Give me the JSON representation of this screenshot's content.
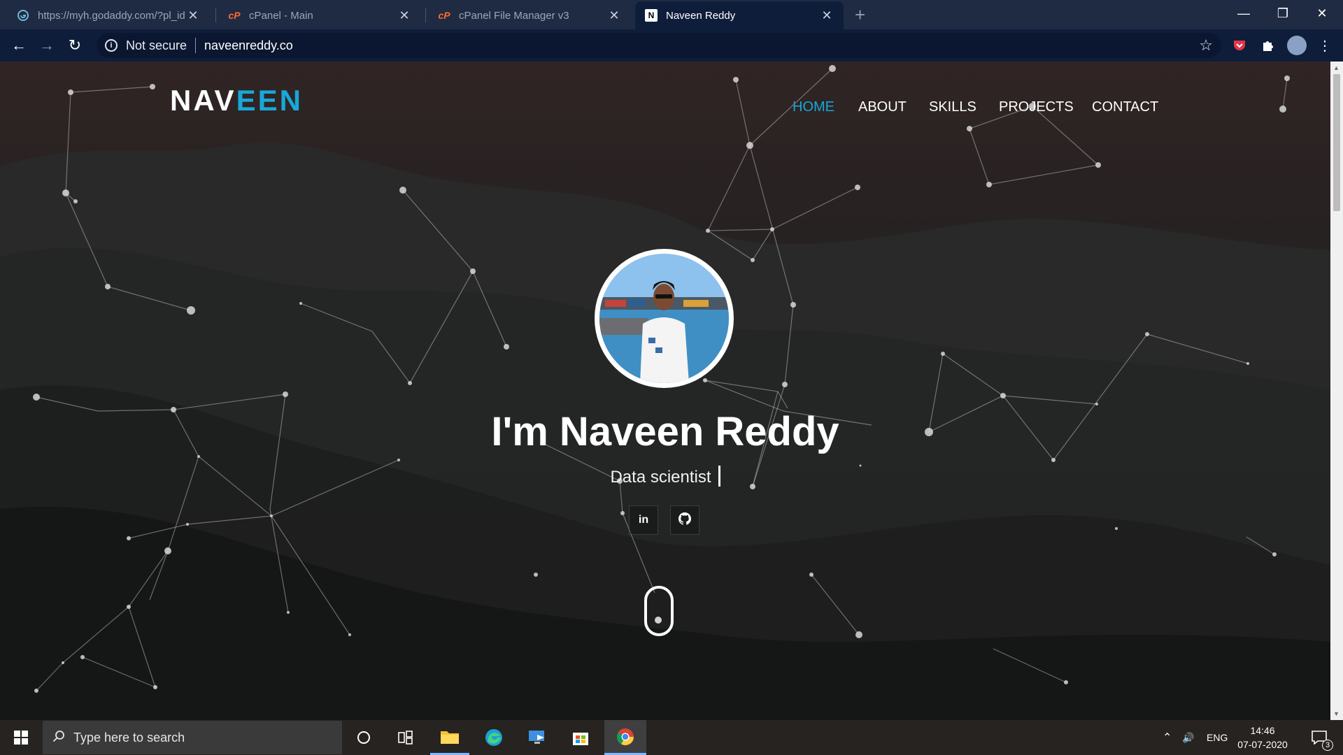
{
  "browser": {
    "tabs": [
      {
        "title": "https://myh.godaddy.com/?pl_id",
        "icon": "godaddy-icon"
      },
      {
        "title": "cPanel - Main",
        "icon": "cpanel-icon"
      },
      {
        "title": "cPanel File Manager v3",
        "icon": "cpanel-icon"
      },
      {
        "title": "Naveen Reddy",
        "icon": "site-n-icon",
        "active": true
      }
    ],
    "security_label": "Not secure",
    "url": "naveenreddy.co"
  },
  "site": {
    "logo_main": "NAV",
    "logo_highlight": "EEN",
    "nav": [
      "HOME",
      "ABOUT",
      "SKILLS",
      "PROJECTS",
      "CONTACT"
    ],
    "nav_active": "HOME",
    "accent_color": "#18a7d8",
    "heading": "I'm Naveen Reddy",
    "tagline": "Data scientist",
    "social": [
      {
        "label": "in",
        "icon": "linkedin-icon"
      },
      {
        "label": "",
        "icon": "github-icon"
      }
    ]
  },
  "taskbar": {
    "search_placeholder": "Type here to search",
    "language": "ENG",
    "time": "14:46",
    "date": "07-07-2020",
    "notification_count": "3"
  }
}
